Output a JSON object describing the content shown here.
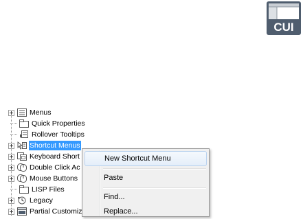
{
  "badge": {
    "text": "CUI"
  },
  "tree": {
    "items": [
      {
        "label": "Menus",
        "icon": "menus-icon",
        "expandable": true
      },
      {
        "label": "Quick Properties",
        "icon": "quick-properties-icon",
        "expandable": false
      },
      {
        "label": "Rollover Tooltips",
        "icon": "rollover-tooltips-icon",
        "expandable": false
      },
      {
        "label": "Shortcut Menus",
        "icon": "shortcut-menus-icon",
        "expandable": true,
        "selected": true
      },
      {
        "label": "Keyboard Short",
        "icon": "keyboard-shortcuts-icon",
        "expandable": true
      },
      {
        "label": "Double Click Ac",
        "icon": "double-click-actions-icon",
        "expandable": true
      },
      {
        "label": "Mouse Buttons",
        "icon": "mouse-buttons-icon",
        "expandable": true
      },
      {
        "label": "LISP Files",
        "icon": "lisp-files-icon",
        "expandable": false
      },
      {
        "label": "Legacy",
        "icon": "legacy-icon",
        "expandable": true
      },
      {
        "label": "Partial Customiz",
        "icon": "partial-customization-icon",
        "expandable": true
      }
    ]
  },
  "context_menu": {
    "items": [
      {
        "label": "New Shortcut Menu",
        "highlighted": true
      },
      {
        "label": "Paste"
      },
      {
        "label": "Find..."
      },
      {
        "label": "Replace..."
      }
    ]
  },
  "colors": {
    "selection": "#3399ff",
    "badge": "#4a5a6c"
  }
}
